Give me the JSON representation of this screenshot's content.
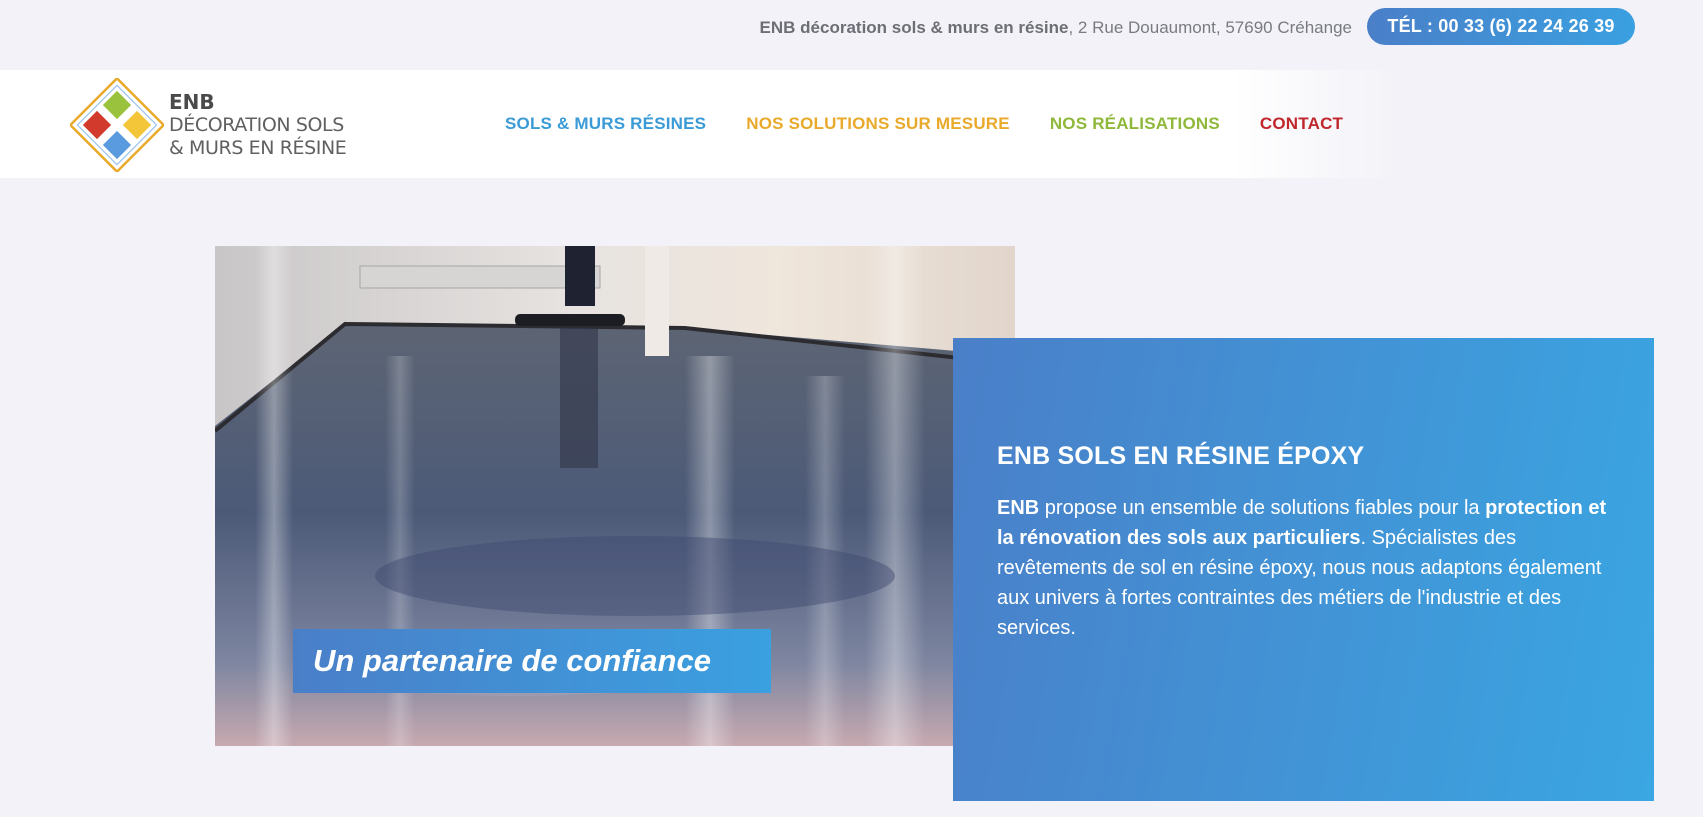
{
  "topbar": {
    "company_name": "ENB décoration sols & murs en résine",
    "address": ", 2 Rue Douaumont, 57690 Créhange",
    "phone_button": "TÉL : 00 33 (6) 22 24 26 39",
    "phone_button_color": "#4a7fc8"
  },
  "logo": {
    "line1": "ENB",
    "line2": "DÉCORATION SOLS",
    "line3": "& MURS EN RÉSINE",
    "icon": "diamond-tiles-logo",
    "colors": [
      "#d23a2c",
      "#9bc23c",
      "#f3c63a",
      "#5a9be0"
    ]
  },
  "nav": [
    {
      "label": "SOLS & MURS RÉSINES",
      "color": "#3a9bd6"
    },
    {
      "label": "NOS SOLUTIONS SUR MESURE",
      "color": "#e9a92b"
    },
    {
      "label": "NOS RÉALISATIONS",
      "color": "#8fb83a"
    },
    {
      "label": "CONTACT",
      "color": "#c0272d"
    }
  ],
  "hero": {
    "image": "epoxy-floor-photo",
    "tagline": "Un partenaire de confiance"
  },
  "info": {
    "title": "ENB SOLS EN RÉSINE ÉPOXY",
    "p_bold1": "ENB",
    "p_text1": " propose un ensemble de solutions fiables pour la ",
    "p_bold2": "protection et la rénovation des sols aux particuliers",
    "p_text2": ". Spécialistes des revêtements de sol en résine époxy, nous nous adaptons également aux univers à fortes contraintes des métiers de l'industrie et des services."
  }
}
